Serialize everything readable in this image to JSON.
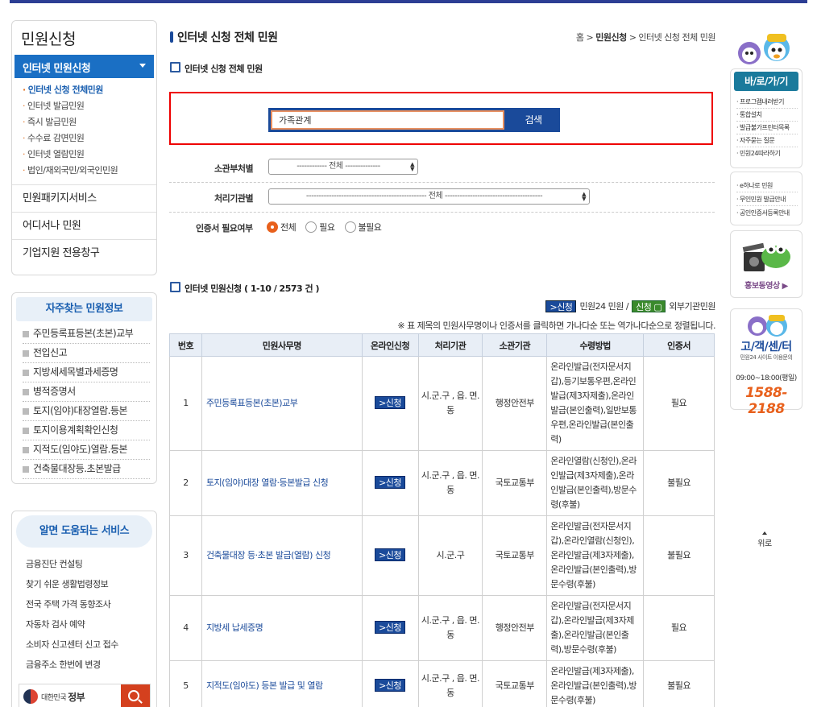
{
  "lnb": {
    "title": "민원신청",
    "active": "인터넷 민원신청",
    "sub": [
      "인터넷 신청 전체민원",
      "인터넷 발급민원",
      "즉시 발급민원",
      "수수료 감면민원",
      "인터넷 열람민원",
      "법인/재외국민/외국인민원"
    ],
    "menus": [
      "민원패키지서비스",
      "어디서나 민원",
      "기업지원 전용창구"
    ]
  },
  "freq": {
    "title": "자주찾는 민원정보",
    "items": [
      "주민등록표등본(초본)교부",
      "전입신고",
      "지방세세목별과세증명",
      "병적증명서",
      "토지(임야)대장열람.등본",
      "토지이용계획확인신청",
      "지적도(임야도)열람.등본",
      "건축물대장등.초본발급"
    ]
  },
  "help": {
    "title": "알면 도움되는 서비스",
    "items": [
      "금융진단 컨설팅",
      "찾기 쉬운 생활법령정보",
      "전국 주택 가격 동향조사",
      "자동차 검사 예약",
      "소비자 신고센터 신고 접수",
      "금융주소 한번에 변경"
    ],
    "gov_small": "대한민국",
    "gov_big": "정부"
  },
  "page": {
    "title": "인터넷 신청 전체 민원",
    "crumb_home": "홈",
    "crumb_sep": ">",
    "crumb_mid": "민원신청",
    "crumb_last": "> 인터넷 신청 전체 민원",
    "section": "인터넷 신청 전체 민원"
  },
  "search": {
    "value": "가족관계",
    "button": "검색"
  },
  "filters": {
    "dept_label": "소관부처별",
    "dept_value": "------------ 전체 --------------",
    "org_label": "처리기관별",
    "org_value": "------------------------------------------------ 전체 ---------------------------------------",
    "cert_label": "인증서 필요여부",
    "cert_options": [
      "전체",
      "필요",
      "불필요"
    ]
  },
  "list": {
    "title": "인터넷 민원신청 ( 1-10 / 2573 건 )",
    "legend_tag1": "신청",
    "legend_text1": "민원24 민원 /",
    "legend_tag2": "신청",
    "legend_text2": "외부기관민원",
    "note": "※ 표 제목의 민원사무명이나 인증서를 클릭하면 가나다순 또는 역가나다순으로 정렬됩니다.",
    "headers": [
      "번호",
      "민원사무명",
      "온라인신청",
      "처리기관",
      "소관기관",
      "수령방법",
      "인증서"
    ],
    "apply_label": "신청",
    "rows": [
      {
        "no": "1",
        "name": "주민등록표등본(초본)교부",
        "org": "시.군.구 , 읍. 면.동",
        "dept": "행정안전부",
        "how": "온라인발급(전자문서지갑),등기보통우편,온라인발급(제3자제출),온라인발급(본인출력),일반보통우편,온라인발급(본인출력)",
        "cert": "필요"
      },
      {
        "no": "2",
        "name": "토지(임야)대장 열람·등본발급 신청",
        "org": "시.군.구 , 읍. 면.동",
        "dept": "국토교통부",
        "how": "온라인열람(신청인),온라인발급(제3자제출),온라인발급(본인출력),방문수령(후불)",
        "cert": "불필요"
      },
      {
        "no": "3",
        "name": "건축물대장 등·초본 발급(열람) 신청",
        "org": "시.군.구",
        "dept": "국토교통부",
        "how": "온라인발급(전자문서지갑),온라인열람(신청인),온라인발급(제3자제출),온라인발급(본인출력),방문수령(후불)",
        "cert": "불필요"
      },
      {
        "no": "4",
        "name": "지방세 납세증명",
        "org": "시.군.구 , 읍. 면.동",
        "dept": "행정안전부",
        "how": "온라인발급(전자문서지갑),온라인발급(제3자제출),온라인발급(본인출력),방문수령(후불)",
        "cert": "필요"
      },
      {
        "no": "5",
        "name": "지적도(임야도) 등본 발급 및 열람",
        "org": "시.군.구 , 읍. 면.동",
        "dept": "국토교통부",
        "how": "온라인발급(제3자제출),온라인발급(본인출력),방문수령(후불)",
        "cert": "불필요"
      }
    ]
  },
  "right": {
    "quick_title": "바/로/가/기",
    "quick_items": [
      "프로그램내려받기",
      "통합설치",
      "발급불가프린터목록",
      "자주묻는 질문",
      "민원24따라하기"
    ],
    "quick2_items": [
      "e하나로 민원",
      "무인민원 발급안내",
      "공인인증서등록안내"
    ],
    "promo": "홍보동영상",
    "callc_title": "고/객/센/터",
    "callc_sub": "민원24 사이트 이용문의",
    "callc_hours": "09:00~18:00(평일)",
    "callc_tel": "1588-2188",
    "top": "위로"
  }
}
